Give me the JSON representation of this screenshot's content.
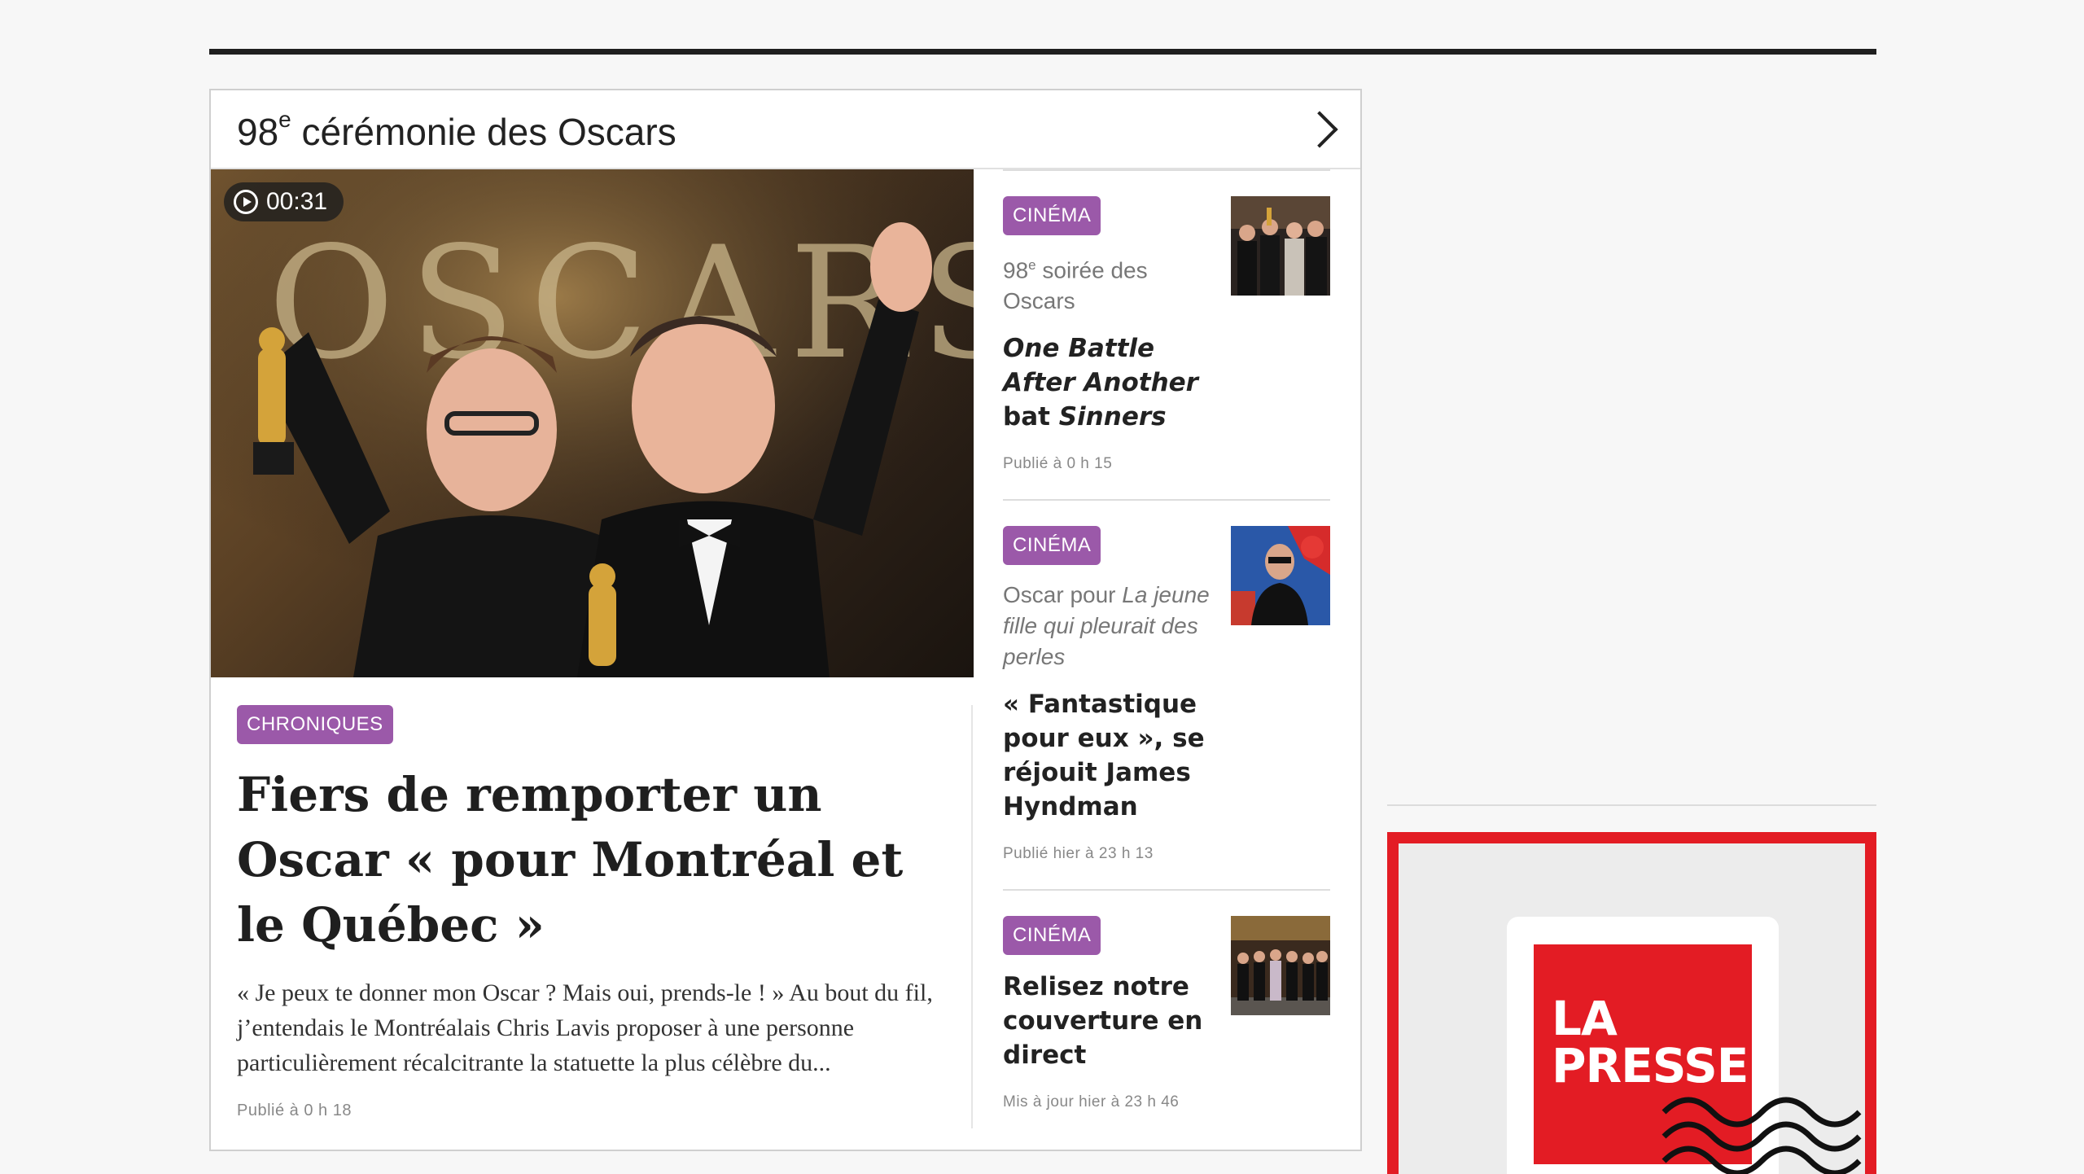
{
  "section": {
    "title_prefix": "98",
    "title_sup": "e",
    "title_rest": " cérémonie des Oscars"
  },
  "hero": {
    "duration": "00:31",
    "backdrop_text": "OSCARS"
  },
  "main_story": {
    "category": "CHRONIQUES",
    "title": "Fiers de remporter un Oscar « pour Montréal et le Québec »",
    "excerpt": "« Je peux te donner mon Oscar ? Mais oui, prends-le ! » Au bout du fil, j’entendais le Montréalais Chris Lavis proposer à une personne particulièrement récalcitrante la statuette la plus célèbre du...",
    "meta": "Publié à 0 h 18"
  },
  "side_items": [
    {
      "category": "CINÉMA",
      "kicker_a": "98",
      "kicker_sup": "e",
      "kicker_b": " soirée des Oscars",
      "title_it1": "One Battle After Another",
      "title_mid": "bat ",
      "title_it2": "Sinners",
      "meta": "Publié à 0 h 15"
    },
    {
      "category": "CINÉMA",
      "kicker_a": "Oscar pour ",
      "kicker_it": "La jeune fille qui pleurait des perles",
      "title": "« Fantastique pour eux », se réjouit James Hyndman",
      "meta": "Publié hier à 23 h 13"
    },
    {
      "category": "CINÉMA",
      "title": "Relisez notre couverture en direct",
      "meta": "Mis à jour hier à 23 h 46"
    }
  ],
  "ad": {
    "logo_line1": "LA",
    "logo_line2": "PRESSE"
  },
  "colors": {
    "badge": "#9b59a9",
    "ad_red": "#e31c24"
  },
  "icons": [
    "chevron-right-icon",
    "play-circle-icon"
  ]
}
